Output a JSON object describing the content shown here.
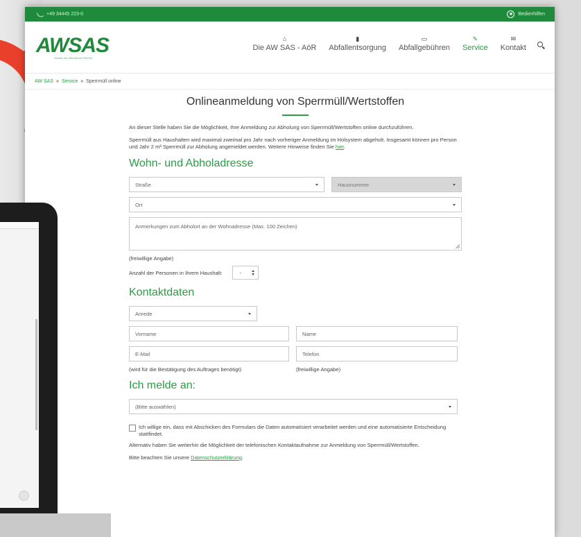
{
  "topbar": {
    "phone": "+49 34445 223-0",
    "accessibility": "Bedienhilfen"
  },
  "logo": {
    "text": "AWSAS",
    "tagline": "Anstalt des öffentlichen Rechts"
  },
  "nav": [
    {
      "label": "Die AW SAS - AöR",
      "icon": "home-icon",
      "glyph": "⌂"
    },
    {
      "label": "Abfallentsorgung",
      "icon": "trash-icon",
      "glyph": "▮"
    },
    {
      "label": "Abfallgebühren",
      "icon": "money-icon",
      "glyph": "▭"
    },
    {
      "label": "Service",
      "icon": "pencil-icon",
      "glyph": "✎",
      "active": true
    },
    {
      "label": "Kontakt",
      "icon": "envelope-icon",
      "glyph": "✉"
    }
  ],
  "breadcrumb": {
    "home": "AW SAS",
    "section": "Service",
    "current": "Sperrmüll online",
    "sep": "»"
  },
  "main": {
    "title": "Onlineanmeldung von Sperrmüll/Wertstoffen",
    "intro": "An dieser Stelle haben Sie die Möglichkeit, Ihre Anmeldung zur Abholung von Sperrmüll/Wertstoffen online durchzuführen.",
    "info": "Sperrmüll aus Haushalten wird maximal zweimal pro Jahr nach vorheriger Anmeldung im Holsystem abgeholt. Insgesamt können pro Person und Jahr 2 m³ Sperrmüll zur Abholung angemeldet werden. Weitere Hinweise finden Sie",
    "info_link": "hier",
    "info_end": "."
  },
  "address": {
    "heading": "Wohn- und Abholadresse",
    "street_placeholder": "Straße",
    "number_placeholder": "Hausnummer",
    "city_placeholder": "Ort",
    "remarks_placeholder": "Anmerkungen zum Abholort an der Wohnadresse (Max. 100 Zeichen)",
    "optional": "(freiwillige Angabe)",
    "persons_label": "Anzahl der Personen in Ihrem Haushalt:",
    "persons_value": "-"
  },
  "contact": {
    "heading": "Kontaktdaten",
    "salutation": "Anrede",
    "firstname": "Vorname",
    "lastname": "Name",
    "email": "E-Mail",
    "phone": "Telefon",
    "email_hint": "(wird für die Bestätigung des Auftrages benötigt)",
    "phone_hint": "(freiwillige Angabe)"
  },
  "register": {
    "heading": "Ich melde an:",
    "select_placeholder": "(Bitte auswählen)",
    "consent": "Ich willige ein, dass mit Abschicken des Formulars die Daten automatisiert verarbeitet werden und eine automatisierte Entscheidung stattfindet.",
    "alternative": "Alternativ haben Sie weiterhin die Möglichkeit der telefonischen Kontaktaufnahme zur Anmeldung von Sperrmüll/Wertstoffen.",
    "privacy_prefix": "Bitte beachten Sie unsere",
    "privacy_link": "Datenschutzerklärung",
    "privacy_end": "."
  },
  "colors": {
    "brand_green": "#2c9c45",
    "topbar_green": "#1f8a3b",
    "arrow_red": "#e8402a"
  }
}
